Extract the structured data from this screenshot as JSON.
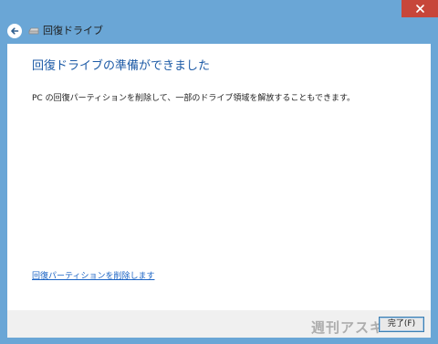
{
  "nav": {
    "title": "回復ドライブ"
  },
  "main": {
    "heading": "回復ドライブの準備ができました",
    "description": "PC の回復パーティションを削除して、一部のドライブ領域を解放することもできます。",
    "delete_link": "回復パーティションを削除します"
  },
  "footer": {
    "finish_label": "完了(F)",
    "watermark": "週刊アスキー"
  },
  "icons": {
    "close": "close-icon",
    "back": "back-arrow-icon",
    "drive": "drive-icon"
  },
  "colors": {
    "frame": "#6aa6d6",
    "close": "#c7463a",
    "heading": "#1c5aa6",
    "link": "#1a63c4"
  }
}
